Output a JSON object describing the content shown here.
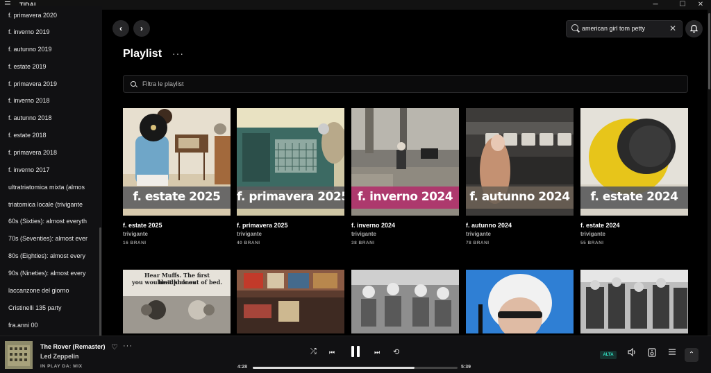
{
  "window": {
    "app_name": "TIDAL",
    "menu_icon": "☰",
    "minimize": "─",
    "maximize": "☐",
    "close": "✕"
  },
  "sidebar": {
    "items": [
      {
        "label": "f. primavera 2020"
      },
      {
        "label": "f. inverno 2019"
      },
      {
        "label": "f. autunno 2019"
      },
      {
        "label": "f. estate 2019"
      },
      {
        "label": "f. primavera 2019"
      },
      {
        "label": "f. inverno 2018"
      },
      {
        "label": "f. autunno 2018"
      },
      {
        "label": "f. estate 2018"
      },
      {
        "label": "f. primavera 2018"
      },
      {
        "label": "f. inverno 2017"
      },
      {
        "label": "ultratriatomica mixta (almos"
      },
      {
        "label": "triatomica locale (trivigante"
      },
      {
        "label": "60s (Sixties): almost everyth"
      },
      {
        "label": "70s (Seventies): almost ever"
      },
      {
        "label": "80s (Eighties): almost every"
      },
      {
        "label": "90s (Nineties): almost every"
      },
      {
        "label": "laccanzone del giorno"
      },
      {
        "label": "Cristinelli 135 party"
      },
      {
        "label": "fra.anni 00"
      }
    ]
  },
  "header": {
    "back": "‹",
    "forward": "›",
    "search_value": "american girl tom petty",
    "search_clear": "✕"
  },
  "main": {
    "title": "Playlist",
    "more": "···",
    "filter_placeholder": "Filtra le playlist",
    "playlists": [
      {
        "cover_text": "f. estate 2025",
        "name": "f. estate 2025",
        "owner": "trivigante",
        "count": "16 BRANI",
        "band_color": "#5b5b5e"
      },
      {
        "cover_text": "f. primavera 2025",
        "name": "f. primavera 2025",
        "owner": "trivigante",
        "count": "40 BRANI",
        "band_color": "#5a5a5c"
      },
      {
        "cover_text": "f. inverno 2024",
        "name": "f. inverno 2024",
        "owner": "trivigante",
        "count": "38 BRANI",
        "band_color": "#b0306a"
      },
      {
        "cover_text": "f. autunno 2024",
        "name": "f. autunno 2024",
        "owner": "trivigante",
        "count": "78 BRANI",
        "band_color": "#6b6054"
      },
      {
        "cover_text": "f. estate 2024",
        "name": "f. estate 2024",
        "owner": "trivigante",
        "count": "55 BRANI",
        "band_color": "#58585a"
      }
    ],
    "second_row_cover_text": {
      "ad_line1": "Hear Muffs. The first headphones",
      "ad_line2": "you wouldn't kick out of bed."
    }
  },
  "player": {
    "track": "The Rover (Remaster)",
    "artist": "Led Zeppelin",
    "source": "IN PLAY DA: MIX",
    "heart": "♡",
    "more": "···",
    "elapsed": "4:28",
    "duration": "5:39",
    "progress_fraction": 0.79,
    "quality": "ALTA",
    "shuffle": "⤮",
    "prev": "⏮",
    "next": "⏭",
    "repeat": "⟲",
    "volume": "🔈",
    "cast": "⧉",
    "queue": "☰",
    "expand": "⌃"
  }
}
